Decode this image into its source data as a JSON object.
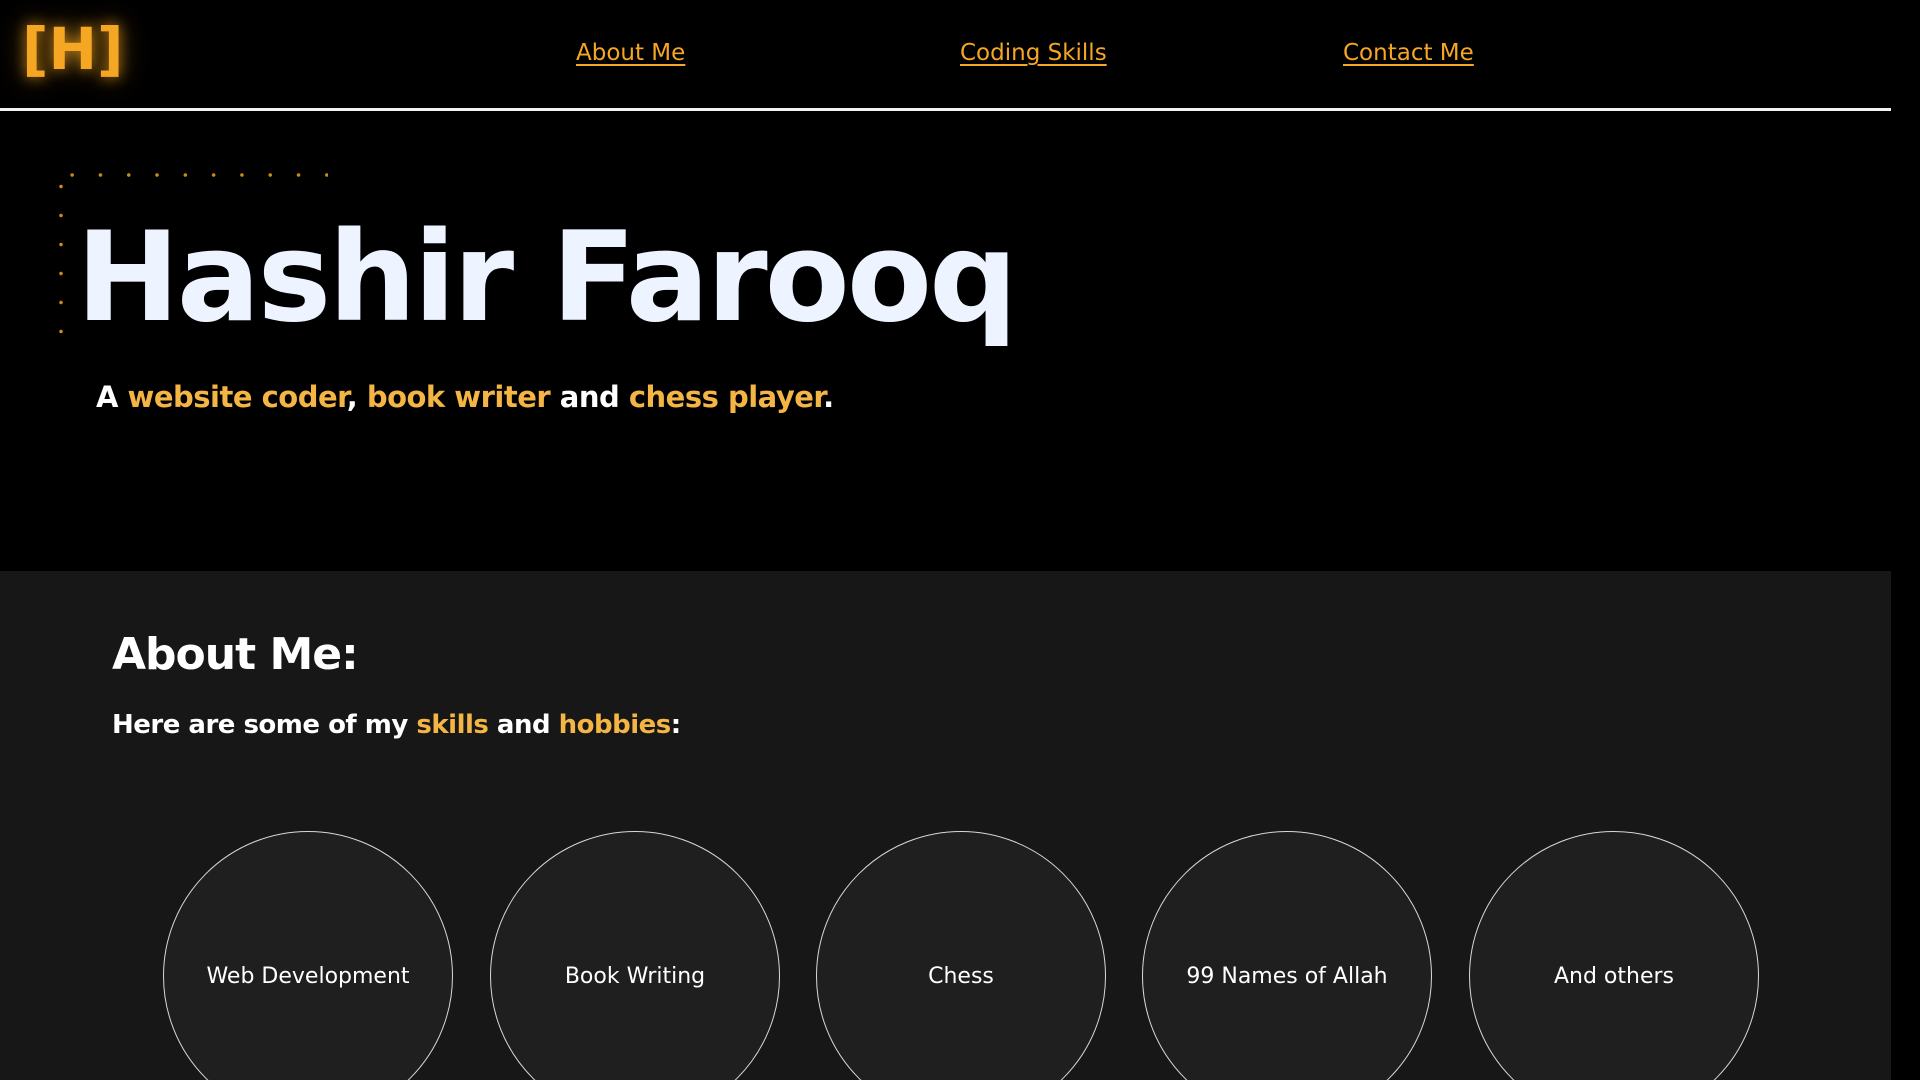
{
  "header": {
    "logo_text": "[H]",
    "nav": [
      {
        "label": "About Me"
      },
      {
        "label": "Coding Skills"
      },
      {
        "label": "Contact Me"
      }
    ]
  },
  "hero": {
    "name": "Hashir Farooq",
    "tagline": {
      "prefix": "A ",
      "skill1": "website coder",
      "sep1": ", ",
      "skill2": "book writer",
      "sep2": " and ",
      "skill3": "chess player",
      "suffix": "."
    }
  },
  "about": {
    "heading": "About Me:",
    "subtitle": {
      "prefix": "Here are some of my ",
      "word1": "skills",
      "mid": " and ",
      "word2": "hobbies",
      "suffix": ":"
    },
    "items": [
      {
        "label": "Web Development"
      },
      {
        "label": "Book Writing"
      },
      {
        "label": "Chess"
      },
      {
        "label": "99 Names of Allah"
      },
      {
        "label": "And others"
      }
    ]
  },
  "colors": {
    "accent": "#f5a623",
    "accent_text": "#f5b544",
    "background": "#000000",
    "section_background": "#171717",
    "circle_background": "#1f1f1f",
    "title_text": "#eef4ff"
  }
}
